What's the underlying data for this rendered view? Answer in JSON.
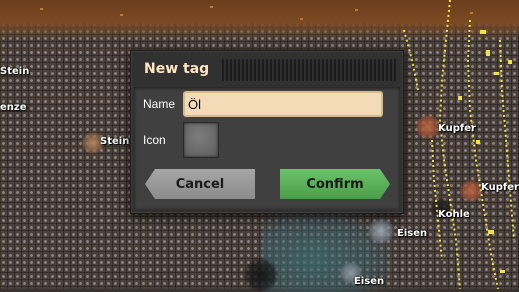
{
  "dialog": {
    "title": "New tag",
    "name_label": "Name",
    "name_value": "Öl",
    "icon_label": "Icon",
    "cancel_label": "Cancel",
    "confirm_label": "Confirm",
    "colors": {
      "title": "#ffe6c0",
      "input_bg": "#f2dbb6",
      "confirm_bg": "#5cb25a",
      "cancel_bg": "#9a9a9a"
    }
  },
  "map": {
    "labels": [
      "Stein",
      "enze",
      "Stein",
      "Kupfer",
      "Kupfer",
      "Kohle",
      "Eisen",
      "Eisen"
    ]
  }
}
